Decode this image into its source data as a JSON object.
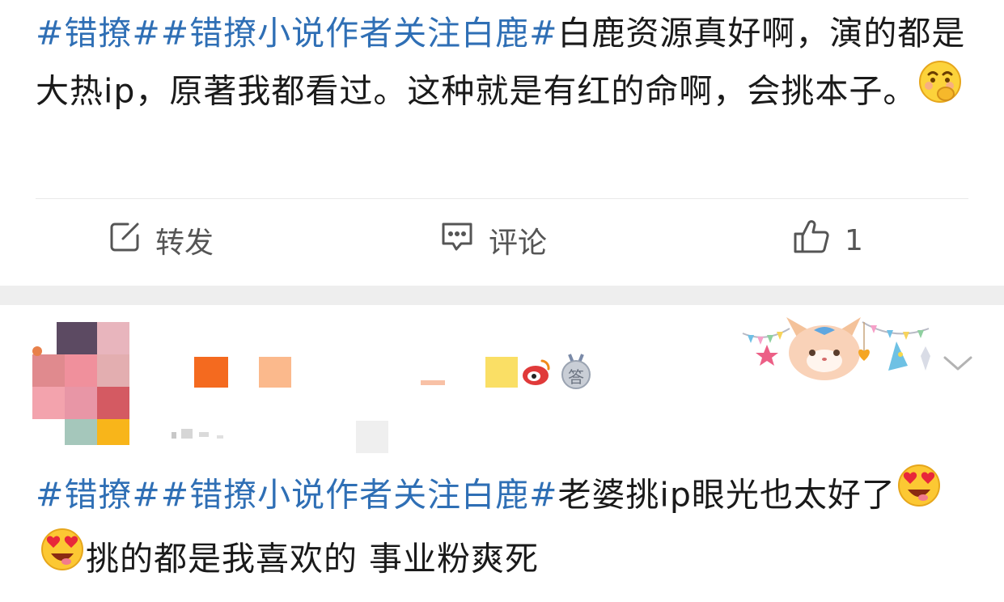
{
  "post1": {
    "tag1": "#错撩#",
    "tag2": "#错撩小说作者关注白鹿#",
    "text": "白鹿资源真好啊，演的都是大热ip，原著我都看过。这种就是有红的命啊，会挑本子。",
    "emoji": "thinking-face"
  },
  "actions": {
    "repost_label": "转发",
    "comment_label": "评论",
    "like_count": "1"
  },
  "post2": {
    "tag1": "#错撩#",
    "tag2": "#错撩小说作者关注白鹿#",
    "text_before": "老婆挑ip眼光也太好了",
    "text_after": "挑的都是我喜欢的 事业粉爽死",
    "emoji": "heart-eyes-face",
    "badge": "答"
  },
  "colors": {
    "tag": "#2f6fb5",
    "text": "#1a1a1a",
    "action": "#555555",
    "separator": "#eeeeee"
  }
}
